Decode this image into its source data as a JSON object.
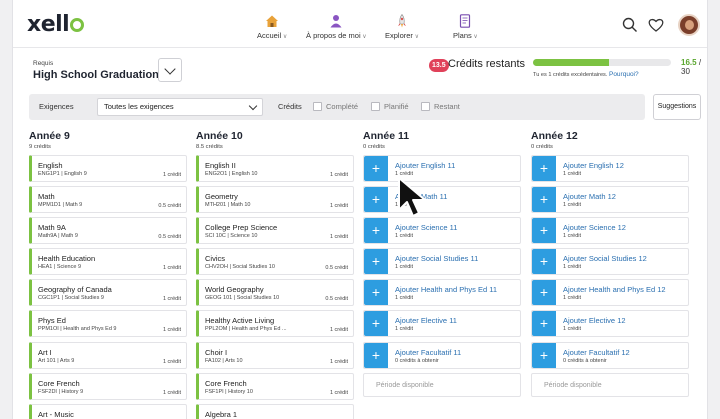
{
  "logo": "xello",
  "nav": [
    {
      "label": "Accueil",
      "icon": "house-icon",
      "color": "#e8a23a"
    },
    {
      "label": "À propos de moi",
      "icon": "person-icon",
      "color": "#8a55c2"
    },
    {
      "label": "Explorer",
      "icon": "rocket-icon",
      "color": "#d9534f"
    },
    {
      "label": "Plans",
      "icon": "document-icon",
      "color": "#7a4fb0"
    }
  ],
  "program": {
    "small_label": "Requis",
    "title": "High School Graduation"
  },
  "credits": {
    "remaining_value": "13.5",
    "remaining_label": "Crédits restants",
    "earned": "16.5",
    "total": "/ 30",
    "progress_fraction": 0.55,
    "excess_text": "Tu es 1 crédits excédentaires.",
    "why_link": "Pourquoi?"
  },
  "filters": {
    "requirements_label": "Exigences",
    "requirements_value": "Toutes les exigences",
    "credits_label": "Crédits",
    "completed": "Complété",
    "planned": "Planifié",
    "remaining": "Restant",
    "suggestions_button": "Suggestions"
  },
  "colors": {
    "accent_green": "#7cc242",
    "add_blue": "#2d9de0",
    "link_blue": "#2a6fb0",
    "badge_red": "#e0415a"
  },
  "years": [
    {
      "title": "Année 9",
      "credits": "9 crédits",
      "courses": [
        {
          "name": "English",
          "code": "ENG1P1  |  English 9",
          "credit": "1 crédit"
        },
        {
          "name": "Math",
          "code": "MPM1D1  |  Math 9",
          "credit": "0.5 crédit"
        },
        {
          "name": "Math 9A",
          "code": "Math9A  |  Math 9",
          "credit": "0.5 crédit"
        },
        {
          "name": "Health Education",
          "code": "HEA1  |  Science 9",
          "credit": "1 crédit"
        },
        {
          "name": "Geography of Canada",
          "code": "CGC1P1  |  Social Studies 9",
          "credit": "1 crédit"
        },
        {
          "name": "Phys Ed",
          "code": "PPM1OI  |  Health and Phys Ed 9",
          "credit": "1 crédit"
        },
        {
          "name": "Art I",
          "code": "Art 101  |  Arts 9",
          "credit": "1 crédit"
        },
        {
          "name": "Core French",
          "code": "FSF2DI  |  History 9",
          "credit": "1 crédit"
        },
        {
          "name": "Art - Music",
          "code": "",
          "credit": ""
        }
      ]
    },
    {
      "title": "Année 10",
      "credits": "8.5 crédits",
      "courses": [
        {
          "name": "English II",
          "code": "ENG2O1  |  English 10",
          "credit": "1 crédit"
        },
        {
          "name": "Geometry",
          "code": "MTH201  |  Math 10",
          "credit": "1 crédit"
        },
        {
          "name": "College Prep Science",
          "code": "SCI 10C  |  Science 10",
          "credit": "1 crédit"
        },
        {
          "name": "Civics",
          "code": "CHV2OH  |  Social Studies 10",
          "credit": "0.5 crédit"
        },
        {
          "name": "World Geography",
          "code": "GEOG 101  |  Social Studies 10",
          "credit": "0.5 crédit"
        },
        {
          "name": "Healthy Active Living",
          "code": "PPL2OM  |  Health and Phys Ed ...",
          "credit": "1 crédit"
        },
        {
          "name": "Choir I",
          "code": "FA102  |  Arts 10",
          "credit": "1 crédit"
        },
        {
          "name": "Core French",
          "code": "FSF1PI  |  History 10",
          "credit": "1 crédit"
        },
        {
          "name": "Algebra 1",
          "code": "",
          "credit": ""
        }
      ]
    },
    {
      "title": "Année 11",
      "credits": "0 crédits",
      "add_items": [
        {
          "name": "Ajouter English 11",
          "credit": "1 crédit"
        },
        {
          "name": "Ajouter Math 11",
          "credit": "1 crédit"
        },
        {
          "name": "Ajouter Science 11",
          "credit": "1 crédit"
        },
        {
          "name": "Ajouter Social Studies 11",
          "credit": "1 crédit"
        },
        {
          "name": "Ajouter Health and Phys Ed 11",
          "credit": "1 crédit"
        },
        {
          "name": "Ajouter Elective 11",
          "credit": "1 crédit"
        },
        {
          "name": "Ajouter Facultatif 11",
          "credit": "0 crédits à obtenir"
        }
      ],
      "empty_slot": "Période disponible"
    },
    {
      "title": "Année 12",
      "credits": "0 crédits",
      "add_items": [
        {
          "name": "Ajouter English 12",
          "credit": "1 crédit"
        },
        {
          "name": "Ajouter Math 12",
          "credit": "1 crédit"
        },
        {
          "name": "Ajouter Science 12",
          "credit": "1 crédit"
        },
        {
          "name": "Ajouter Social Studies 12",
          "credit": "1 crédit"
        },
        {
          "name": "Ajouter Health and Phys Ed 12",
          "credit": "1 crédit"
        },
        {
          "name": "Ajouter Elective 12",
          "credit": "1 crédit"
        },
        {
          "name": "Ajouter Facultatif 12",
          "credit": "0 crédits à obtenir"
        }
      ],
      "empty_slot": "Période disponible"
    }
  ]
}
